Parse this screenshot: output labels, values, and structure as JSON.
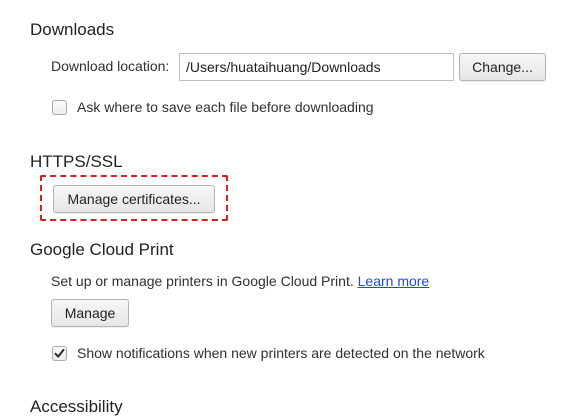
{
  "downloads": {
    "title": "Downloads",
    "location_label": "Download location:",
    "location_value": "/Users/huataihuang/Downloads",
    "change_button": "Change...",
    "ask_checkbox_label": "Ask where to save each file before downloading",
    "ask_checkbox_checked": false
  },
  "https": {
    "title": "HTTPS/SSL",
    "manage_certificates_button": "Manage certificates..."
  },
  "cloud_print": {
    "title": "Google Cloud Print",
    "description": "Set up or manage printers in Google Cloud Print.",
    "learn_more_link": "Learn more",
    "manage_button": "Manage",
    "notify_checkbox_label": "Show notifications when new printers are detected on the network",
    "notify_checkbox_checked": true
  },
  "accessibility": {
    "title": "Accessibility"
  },
  "colors": {
    "highlight_border": "#d82020",
    "link": "#1a4fc8"
  }
}
